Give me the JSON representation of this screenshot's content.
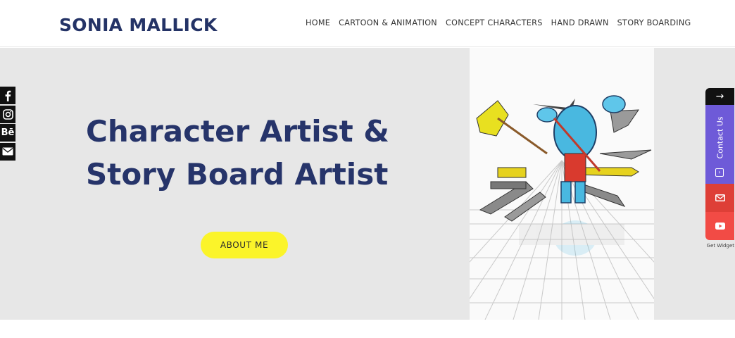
{
  "site": {
    "brand": "SONIA MALLICK"
  },
  "nav": {
    "items": [
      "HOME",
      "CARTOON & ANIMATION",
      "CONCEPT CHARACTERS",
      "HAND DRAWN",
      "STORY BOARDING"
    ]
  },
  "hero": {
    "headline_line1": "Character Artist &",
    "headline_line2": "Story Board Artist",
    "button_label": "ABOUT ME"
  },
  "social": {
    "icons": [
      "facebook-icon",
      "instagram-icon",
      "behance-icon",
      "email-icon"
    ],
    "behance_label": "Bē"
  },
  "widget": {
    "toggle_glyph": "→",
    "contact_label": "Contact Us",
    "footer_text": "Get Widget"
  },
  "colors": {
    "brand": "#243366",
    "hero_bg": "#e7e7e7",
    "button": "#fbf42a",
    "contact": "#6e5ad8",
    "mail": "#de3f37",
    "youtube": "#f24b45"
  }
}
